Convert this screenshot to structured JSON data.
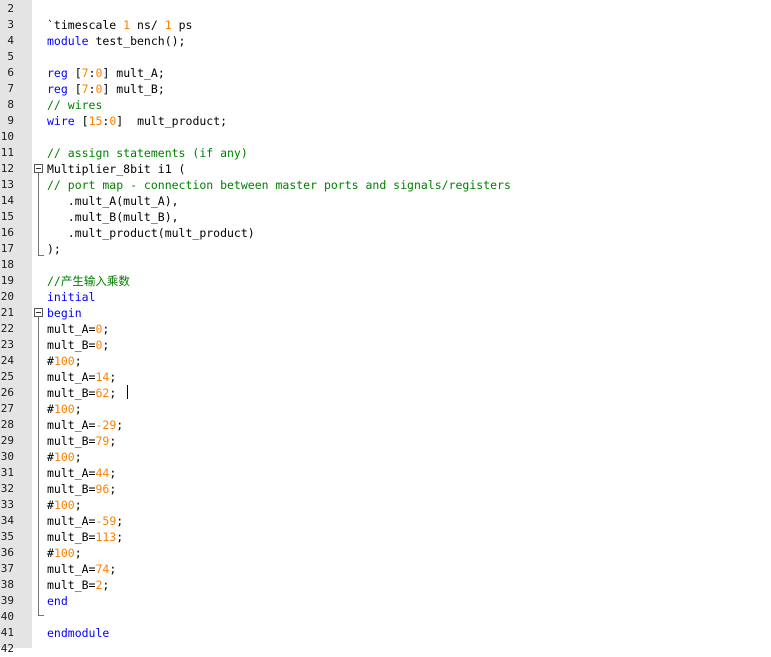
{
  "editor": {
    "lines": [
      {
        "n": "2",
        "segs": []
      },
      {
        "n": "3",
        "segs": [
          [
            "p",
            "`timescale "
          ],
          [
            "num",
            "1"
          ],
          [
            "p",
            " ns/ "
          ],
          [
            "num",
            "1"
          ],
          [
            "p",
            " ps"
          ]
        ]
      },
      {
        "n": "4",
        "segs": [
          [
            "kw",
            "module"
          ],
          [
            "p",
            " test_bench();"
          ]
        ]
      },
      {
        "n": "5",
        "segs": []
      },
      {
        "n": "6",
        "segs": [
          [
            "kw",
            "reg"
          ],
          [
            "p",
            " ["
          ],
          [
            "num",
            "7"
          ],
          [
            "p",
            ":"
          ],
          [
            "num",
            "0"
          ],
          [
            "p",
            "] mult_A;"
          ]
        ]
      },
      {
        "n": "7",
        "segs": [
          [
            "kw",
            "reg"
          ],
          [
            "p",
            " ["
          ],
          [
            "num",
            "7"
          ],
          [
            "p",
            ":"
          ],
          [
            "num",
            "0"
          ],
          [
            "p",
            "] mult_B;"
          ]
        ]
      },
      {
        "n": "8",
        "segs": [
          [
            "cm",
            "// wires"
          ]
        ]
      },
      {
        "n": "9",
        "segs": [
          [
            "kw",
            "wire"
          ],
          [
            "p",
            " ["
          ],
          [
            "num",
            "15"
          ],
          [
            "p",
            ":"
          ],
          [
            "num",
            "0"
          ],
          [
            "p",
            "]  mult_product;"
          ]
        ]
      },
      {
        "n": "10",
        "segs": []
      },
      {
        "n": "11",
        "segs": [
          [
            "cm",
            "// assign statements (if any)"
          ]
        ]
      },
      {
        "n": "12",
        "segs": [
          [
            "p",
            "Multiplier_8bit i1 ("
          ]
        ]
      },
      {
        "n": "13",
        "segs": [
          [
            "cm",
            "// port map - connection between master ports and signals/registers"
          ]
        ]
      },
      {
        "n": "14",
        "segs": [
          [
            "p",
            "   .mult_A(mult_A),"
          ]
        ]
      },
      {
        "n": "15",
        "segs": [
          [
            "p",
            "   .mult_B(mult_B),"
          ]
        ]
      },
      {
        "n": "16",
        "segs": [
          [
            "p",
            "   .mult_product(mult_product)"
          ]
        ]
      },
      {
        "n": "17",
        "segs": [
          [
            "p",
            ");"
          ]
        ]
      },
      {
        "n": "18",
        "segs": []
      },
      {
        "n": "19",
        "segs": [
          [
            "cm",
            "//产生输入乘数"
          ]
        ]
      },
      {
        "n": "20",
        "segs": [
          [
            "kw",
            "initial"
          ]
        ]
      },
      {
        "n": "21",
        "segs": [
          [
            "kw",
            "begin"
          ]
        ]
      },
      {
        "n": "22",
        "segs": [
          [
            "p",
            "mult_A="
          ],
          [
            "num",
            "0"
          ],
          [
            "p",
            ";"
          ]
        ]
      },
      {
        "n": "23",
        "segs": [
          [
            "p",
            "mult_B="
          ],
          [
            "num",
            "0"
          ],
          [
            "p",
            ";"
          ]
        ]
      },
      {
        "n": "24",
        "segs": [
          [
            "p",
            "#"
          ],
          [
            "num",
            "100"
          ],
          [
            "p",
            ";"
          ]
        ]
      },
      {
        "n": "25",
        "segs": [
          [
            "p",
            "mult_A="
          ],
          [
            "num",
            "14"
          ],
          [
            "p",
            ";"
          ]
        ]
      },
      {
        "n": "26",
        "segs": [
          [
            "p",
            "mult_B="
          ],
          [
            "num",
            "62"
          ],
          [
            "p",
            ";"
          ]
        ]
      },
      {
        "n": "27",
        "segs": [
          [
            "p",
            "#"
          ],
          [
            "num",
            "100"
          ],
          [
            "p",
            ";"
          ]
        ]
      },
      {
        "n": "28",
        "segs": [
          [
            "p",
            "mult_A="
          ],
          [
            "num",
            "-29"
          ],
          [
            "p",
            ";"
          ]
        ]
      },
      {
        "n": "29",
        "segs": [
          [
            "p",
            "mult_B="
          ],
          [
            "num",
            "79"
          ],
          [
            "p",
            ";"
          ]
        ]
      },
      {
        "n": "30",
        "segs": [
          [
            "p",
            "#"
          ],
          [
            "num",
            "100"
          ],
          [
            "p",
            ";"
          ]
        ]
      },
      {
        "n": "31",
        "segs": [
          [
            "p",
            "mult_A="
          ],
          [
            "num",
            "44"
          ],
          [
            "p",
            ";"
          ]
        ]
      },
      {
        "n": "32",
        "segs": [
          [
            "p",
            "mult_B="
          ],
          [
            "num",
            "96"
          ],
          [
            "p",
            ";"
          ]
        ]
      },
      {
        "n": "33",
        "segs": [
          [
            "p",
            "#"
          ],
          [
            "num",
            "100"
          ],
          [
            "p",
            ";"
          ]
        ]
      },
      {
        "n": "34",
        "segs": [
          [
            "p",
            "mult_A="
          ],
          [
            "num",
            "-59"
          ],
          [
            "p",
            ";"
          ]
        ]
      },
      {
        "n": "35",
        "segs": [
          [
            "p",
            "mult_B="
          ],
          [
            "num",
            "113"
          ],
          [
            "p",
            ";"
          ]
        ]
      },
      {
        "n": "36",
        "segs": [
          [
            "p",
            "#"
          ],
          [
            "num",
            "100"
          ],
          [
            "p",
            ";"
          ]
        ]
      },
      {
        "n": "37",
        "segs": [
          [
            "p",
            "mult_A="
          ],
          [
            "num",
            "74"
          ],
          [
            "p",
            ";"
          ]
        ]
      },
      {
        "n": "38",
        "segs": [
          [
            "p",
            "mult_B="
          ],
          [
            "num",
            "2"
          ],
          [
            "p",
            ";"
          ]
        ]
      },
      {
        "n": "39",
        "segs": [
          [
            "kw",
            "end"
          ]
        ]
      },
      {
        "n": "40",
        "segs": []
      },
      {
        "n": "41",
        "segs": [
          [
            "kw",
            "endmodule"
          ]
        ]
      },
      {
        "n": "42",
        "segs": []
      }
    ]
  },
  "colors": {
    "keyword": "#0000ff",
    "comment": "#008000",
    "number": "#ff8000",
    "gutter": "#e4e4e4"
  }
}
